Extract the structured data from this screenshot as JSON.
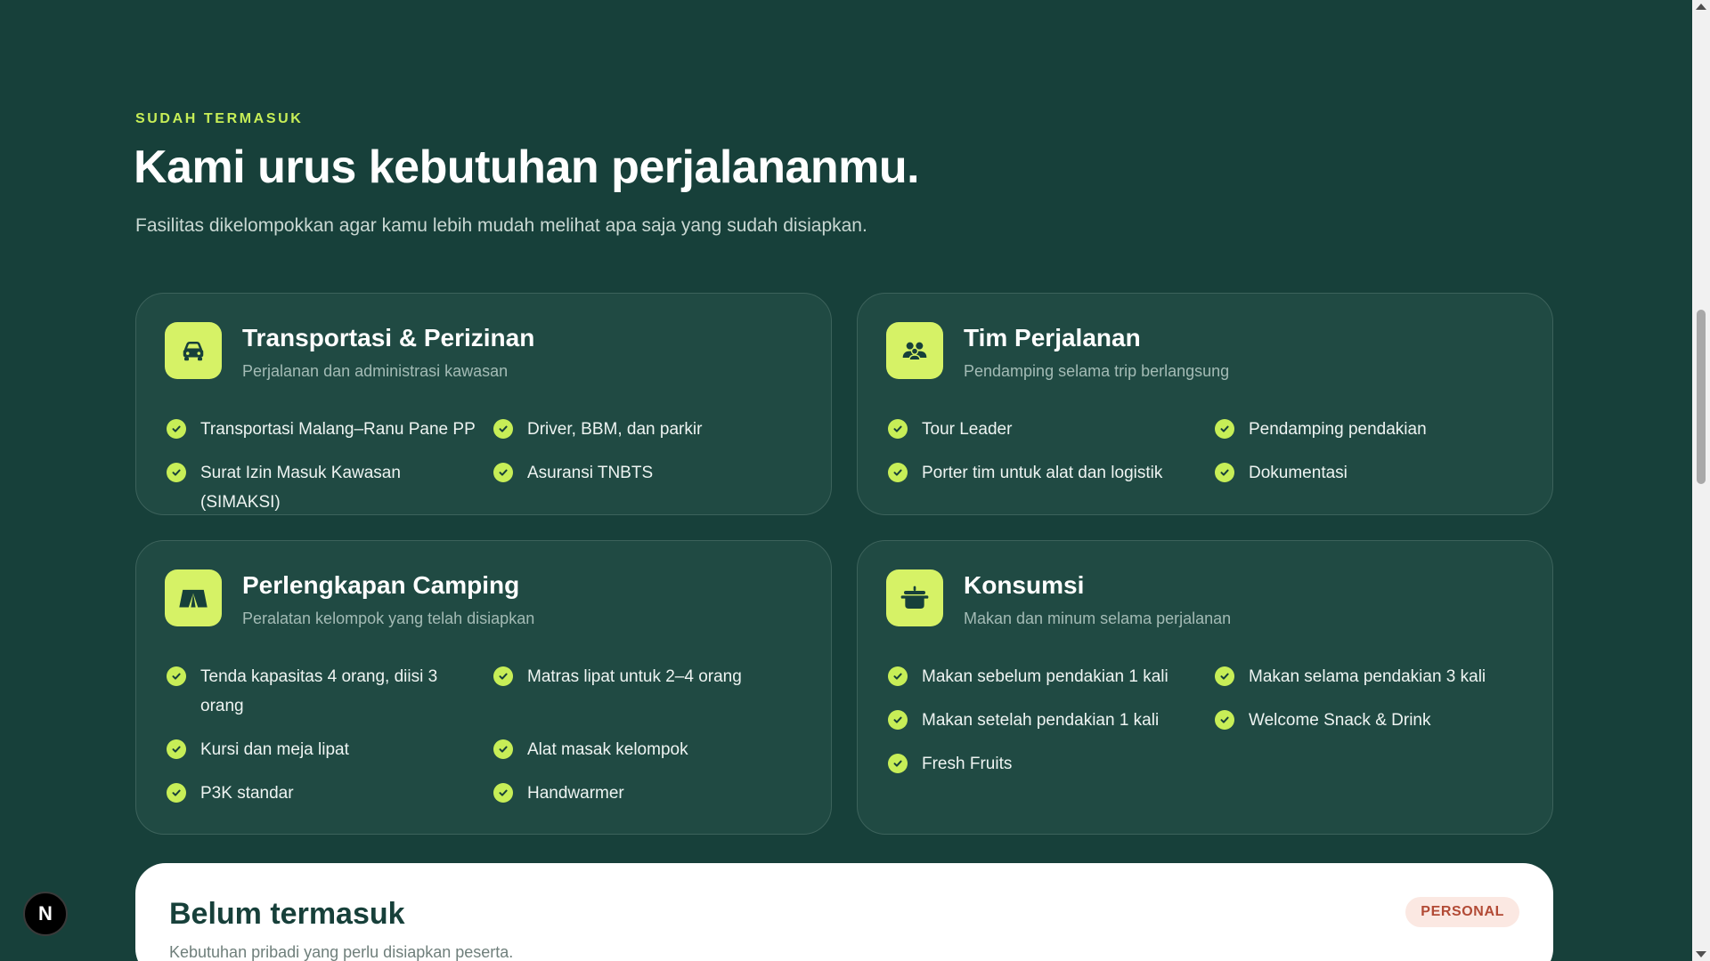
{
  "section": {
    "eyebrow": "SUDAH TERMASUK",
    "title": "Kami urus kebutuhan perjalananmu.",
    "subtitle": "Fasilitas dikelompokkan agar kamu lebih mudah melihat apa saja yang sudah disiapkan."
  },
  "cards": [
    {
      "title": "Transportasi & Perizinan",
      "subtitle": "Perjalanan dan administrasi kawasan",
      "icon": "car-icon",
      "items": [
        "Transportasi Malang–Ranu Pane PP",
        "Driver, BBM, dan parkir",
        "Surat Izin Masuk Kawasan (SIMAKSI)",
        "Asuransi TNBTS"
      ]
    },
    {
      "title": "Tim Perjalanan",
      "subtitle": "Pendamping selama trip berlangsung",
      "icon": "team-icon",
      "items": [
        "Tour Leader",
        "Pendamping pendakian",
        "Porter tim untuk alat dan logistik",
        "Dokumentasi"
      ]
    },
    {
      "title": "Perlengkapan Camping",
      "subtitle": "Peralatan kelompok yang telah disiapkan",
      "icon": "tent-icon",
      "items": [
        "Tenda kapasitas 4 orang, diisi 3 orang",
        "Matras lipat untuk 2–4 orang",
        "Kursi dan meja lipat",
        "Alat masak kelompok",
        "P3K standar",
        "Handwarmer"
      ]
    },
    {
      "title": "Konsumsi",
      "subtitle": "Makan dan minum selama perjalanan",
      "icon": "cooking-pot-icon",
      "items": [
        "Makan sebelum pendakian 1 kali",
        "Makan selama pendakian 3 kali",
        "Makan setelah pendakian 1 kali",
        "Welcome Snack & Drink",
        "Fresh Fruits"
      ]
    }
  ],
  "excluded": {
    "title": "Belum termasuk",
    "subtitle": "Kebutuhan pribadi yang perlu disiapkan peserta.",
    "badge": "PERSONAL"
  },
  "floating_button": {
    "label": "N"
  },
  "colors": {
    "background": "#17403a",
    "card": "#204a43",
    "accent": "#c7ee57",
    "badge_bg": "#fbe8e2",
    "badge_text": "#b24a35"
  }
}
